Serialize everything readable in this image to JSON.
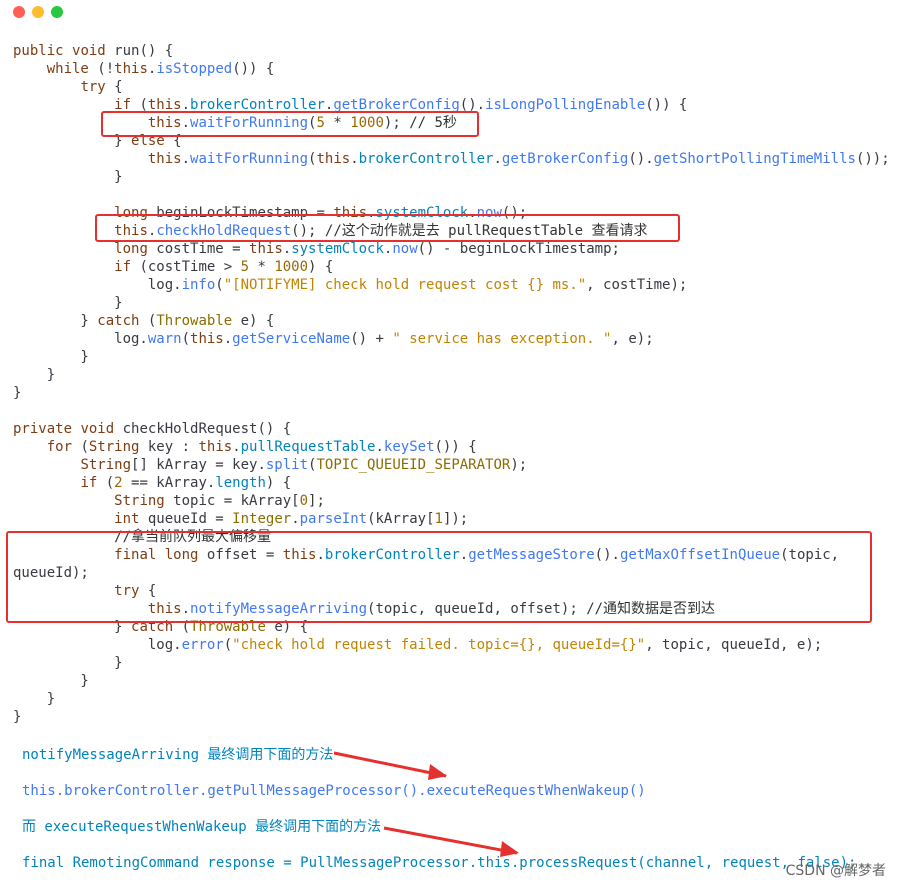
{
  "window": {
    "traffic_lights": {
      "close": "#ff5f57",
      "minimize": "#febc2e",
      "maximize": "#28c840"
    }
  },
  "code_lines": [
    "public void run() {",
    "    while (!this.isStopped()) {",
    "        try {",
    "            if (this.brokerController.getBrokerConfig().isLongPollingEnable()) {",
    "                this.waitForRunning(5 * 1000); // 5秒",
    "            } else {",
    "                this.waitForRunning(this.brokerController.getBrokerConfig().getShortPollingTimeMills());",
    "            }",
    "",
    "            long beginLockTimestamp = this.systemClock.now();",
    "            this.checkHoldRequest(); //这个动作就是去 pullRequestTable 查看请求",
    "            long costTime = this.systemClock.now() - beginLockTimestamp;",
    "            if (costTime > 5 * 1000) {",
    "                log.info(\"[NOTIFYME] check hold request cost {} ms.\", costTime);",
    "            }",
    "        } catch (Throwable e) {",
    "            log.warn(this.getServiceName() + \" service has exception. \", e);",
    "        }",
    "    }",
    "}",
    "",
    "private void checkHoldRequest() {",
    "    for (String key : this.pullRequestTable.keySet()) {",
    "        String[] kArray = key.split(TOPIC_QUEUEID_SEPARATOR);",
    "        if (2 == kArray.length) {",
    "            String topic = kArray[0];",
    "            int queueId = Integer.parseInt(kArray[1]);",
    "            //拿当前队列最大偏移量",
    "            final long offset = this.brokerController.getMessageStore().getMaxOffsetInQueue(topic,",
    "queueId);",
    "            try {",
    "                this.notifyMessageArriving(topic, queueId, offset); //通知数据是否到达",
    "            } catch (Throwable e) {",
    "                log.error(\"check hold request failed. topic={}, queueId={}\", topic, queueId, e);",
    "            }",
    "        }",
    "    }",
    "}"
  ],
  "notes": [
    "notifyMessageArriving 最终调用下面的方法",
    "this.brokerController.getPullMessageProcessor().executeRequestWhenWakeup()",
    "而 executeRequestWhenWakeup 最终调用下面的方法",
    "final RemotingCommand response = PullMessageProcessor.this.processRequest(channel, request, false);"
  ],
  "watermark": "CSDN @解梦者",
  "colors": {
    "highlight_box": "#e53030",
    "arrow": "#e53030"
  }
}
